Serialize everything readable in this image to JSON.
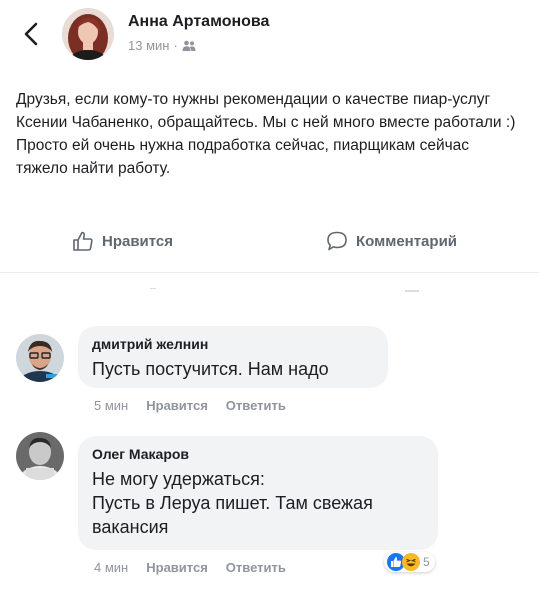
{
  "post": {
    "author": "Анна Артамонова",
    "time": "13 мин",
    "separator": "·",
    "audience_icon": "friends-icon",
    "text": "Друзья, если кому-то нужны рекомендации о качестве пиар-услуг Ксении Чабаненко, обращайтесь. Мы с ней много вместе работали :) Просто ей очень нужна подработка сейчас, пиарщикам сейчас тяжело найти работу.",
    "like_label": "Нравится",
    "comment_label": "Комментарий"
  },
  "comments": [
    {
      "name": "дмитрий желнин",
      "text": "Пусть постучится. Нам надо",
      "time": "5 мин",
      "like": "Нравится",
      "reply": "Ответить"
    },
    {
      "name": "Олег Макаров",
      "text_lines": [
        "Не могу удержаться:",
        "Пусть в Леруа пишет. Там свежая",
        "вакансия"
      ],
      "time": "4 мин",
      "like": "Нравится",
      "reply": "Ответить",
      "reactions": {
        "icons": [
          "like-reaction-icon",
          "haha-reaction-icon"
        ],
        "count": "5"
      }
    }
  ],
  "colors": {
    "text": "#1c1e21",
    "secondary": "#90949c",
    "bubble": "#f2f3f5",
    "like_blue": "#1877f2",
    "haha_yellow": "#f7b928"
  }
}
